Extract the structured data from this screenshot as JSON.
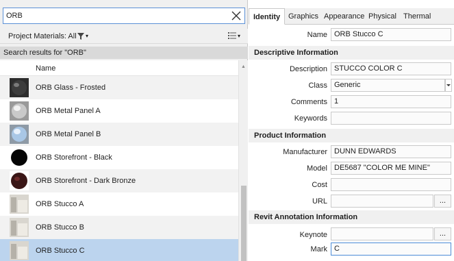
{
  "search": {
    "value": "ORB",
    "clear_icon": "close-icon"
  },
  "filter": {
    "label": "Project Materials: All",
    "filter_icon": "funnel-icon",
    "caret": "▾",
    "view_icon": "list-view-icon"
  },
  "results": {
    "label": "Search results for \"ORB\""
  },
  "list": {
    "header": "Name",
    "items": [
      {
        "label": "ORB Glass - Frosted",
        "thumb": "dark-sphere"
      },
      {
        "label": "ORB Metal Panel A",
        "thumb": "grey-sphere"
      },
      {
        "label": "ORB Metal Panel B",
        "thumb": "blue-sphere"
      },
      {
        "label": "ORB Storefront - Black",
        "thumb": "black-sphere"
      },
      {
        "label": "ORB Storefront - Dark Bronze",
        "thumb": "bronze-sphere"
      },
      {
        "label": "ORB Stucco A",
        "thumb": "stucco-texture"
      },
      {
        "label": "ORB Stucco B",
        "thumb": "stucco-texture"
      },
      {
        "label": "ORB Stucco C",
        "thumb": "stucco-texture"
      }
    ],
    "selected_index": 7
  },
  "tabs": [
    "Identity",
    "Graphics",
    "Appearance",
    "Physical",
    "Thermal"
  ],
  "active_tab": "Identity",
  "identity": {
    "name_label": "Name",
    "name_value": "ORB Stucco C",
    "descriptive": {
      "title": "Descriptive Information",
      "description_label": "Description",
      "description_value": "STUCCO COLOR C",
      "class_label": "Class",
      "class_value": "Generic",
      "comments_label": "Comments",
      "comments_value": "1",
      "keywords_label": "Keywords",
      "keywords_value": ""
    },
    "product": {
      "title": "Product Information",
      "manufacturer_label": "Manufacturer",
      "manufacturer_value": "DUNN EDWARDS",
      "model_label": "Model",
      "model_value": "DE5687 \"COLOR ME MINE\"",
      "cost_label": "Cost",
      "cost_value": "",
      "url_label": "URL",
      "url_value": "",
      "url_button": "..."
    },
    "annotation": {
      "title": "Revit Annotation Information",
      "keynote_label": "Keynote",
      "keynote_value": "",
      "keynote_button": "...",
      "mark_label": "Mark",
      "mark_value": "C"
    }
  },
  "colors": {
    "selection": "#bcd4ee",
    "focus_border": "#4b8bd6",
    "panel": "#f0f0f0"
  }
}
